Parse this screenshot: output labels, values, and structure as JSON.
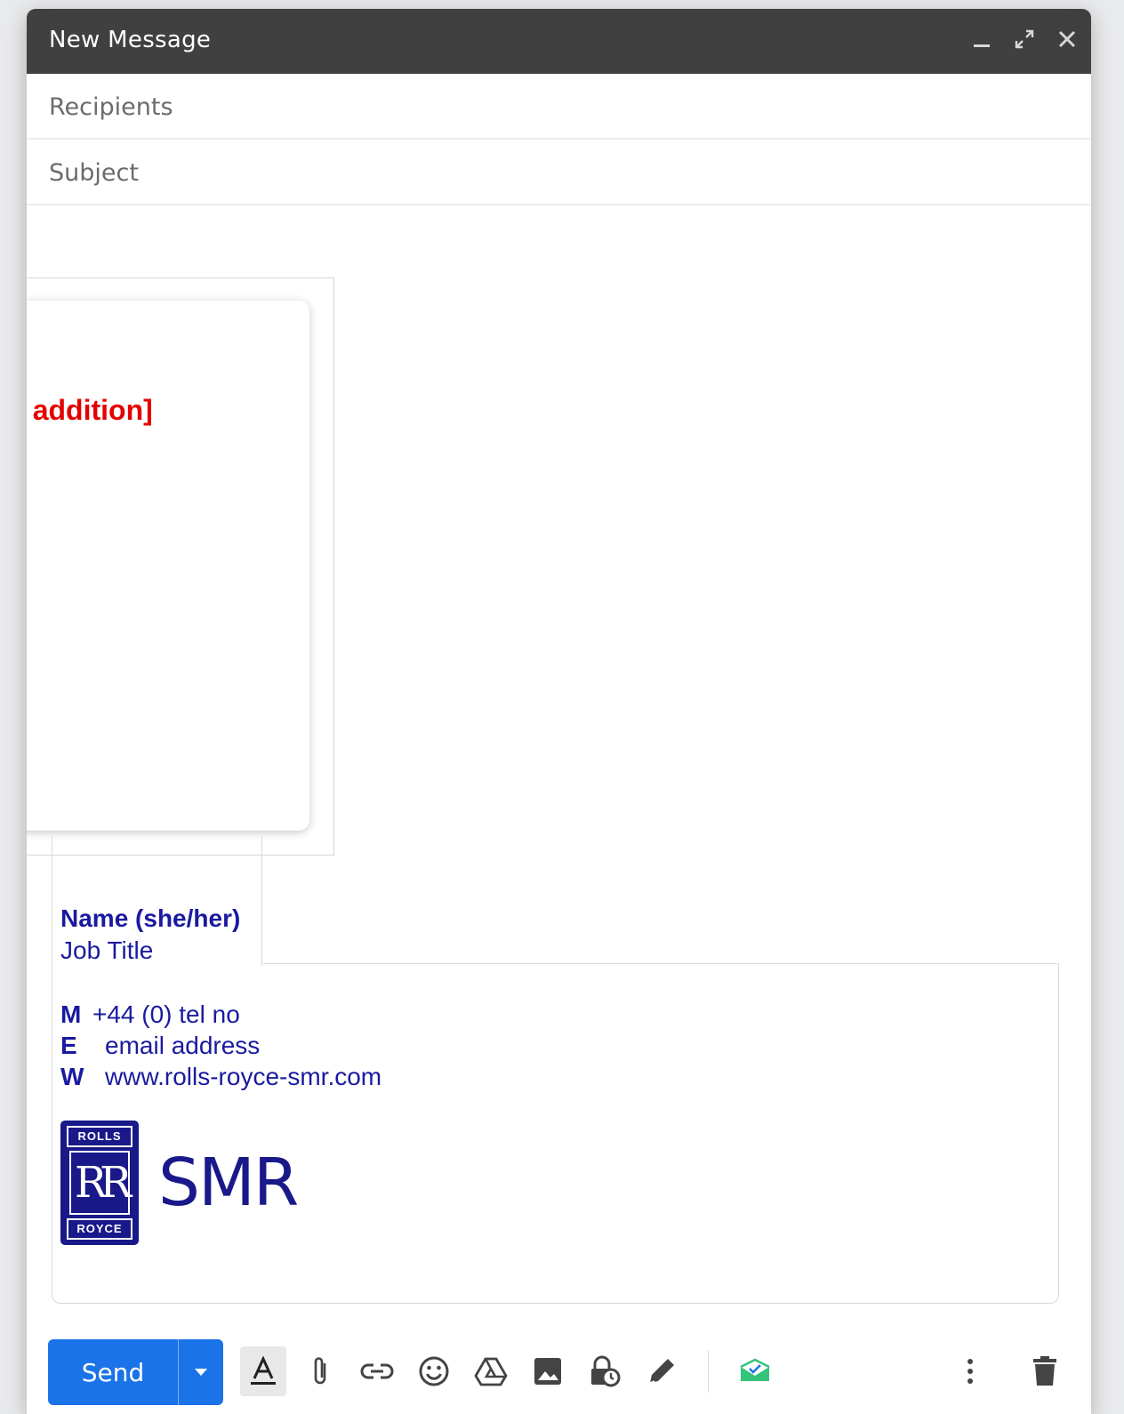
{
  "window": {
    "title": "New Message"
  },
  "fields": {
    "recipients_placeholder": "Recipients",
    "subject_placeholder": "Subject"
  },
  "popup": {
    "text": "untary addition]"
  },
  "signature": {
    "name": "Name (she/her)",
    "job_title": "Job Title",
    "mobile_label": "M",
    "mobile_value": "+44 (0) tel no",
    "email_label": "E",
    "email_value": "email address",
    "web_label": "W",
    "web_value": "www.rolls-royce-smr.com",
    "logo_top": "ROLLS",
    "logo_mono": "RR",
    "logo_bottom": "ROYCE",
    "logo_wordmark": "SMR"
  },
  "toolbar": {
    "send_label": "Send"
  },
  "colors": {
    "titlebar": "#404040",
    "send": "#1a73e8",
    "signature": "#1a1aa0",
    "popup_text": "#e50000"
  }
}
